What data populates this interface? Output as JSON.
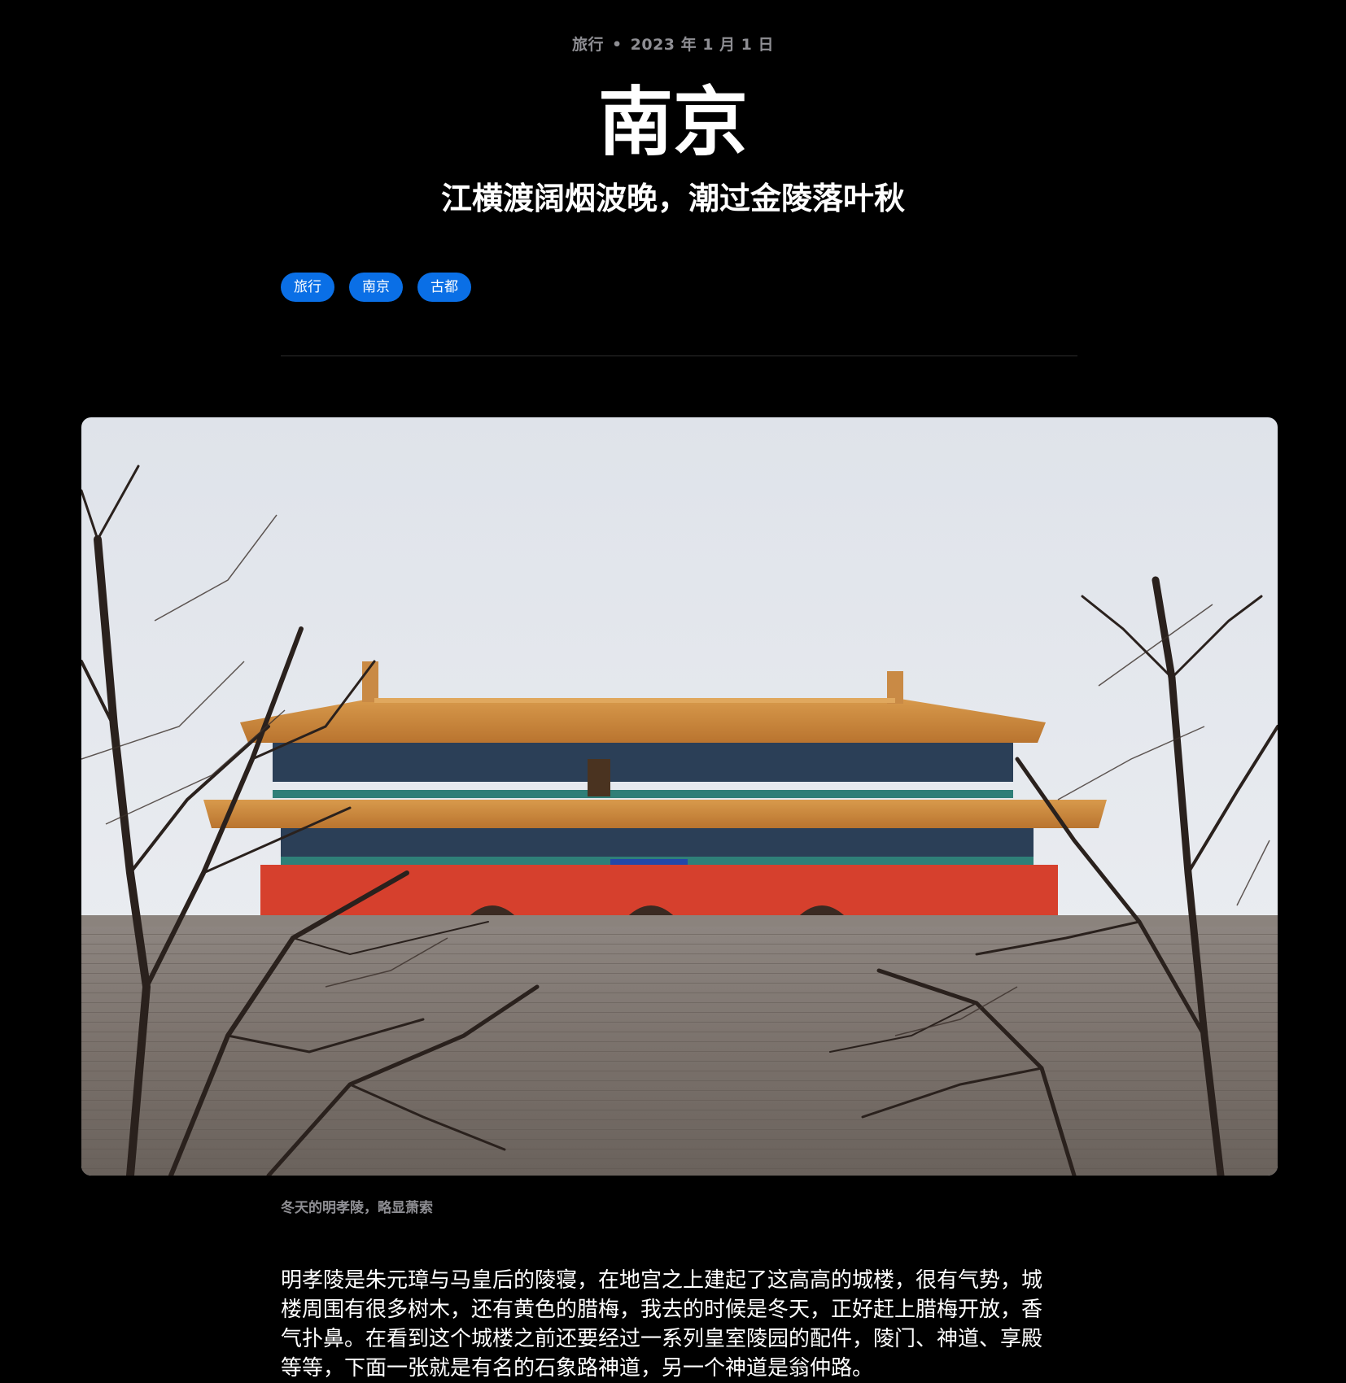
{
  "article": {
    "category": "旅行",
    "separator": "•",
    "date": "2023 年 1 月 1 日",
    "title": "南京",
    "subtitle": "江横渡阔烟波晚，潮过金陵落叶秋",
    "tags": [
      "旅行",
      "南京",
      "古都"
    ],
    "figure": {
      "caption": "冬天的明孝陵，略显萧索"
    },
    "paragraph": "明孝陵是朱元璋与马皇后的陵寝，在地宫之上建起了这高高的城楼，很有气势，城楼周围有很多树木，还有黄色的腊梅，我去的时候是冬天，正好赶上腊梅开放，香气扑鼻。在看到这个城楼之前还要经过一系列皇室陵园的配件，陵门、神道、享殿等等，下面一张就是有名的石象路神道，另一个神道是翁仲路。"
  },
  "colors": {
    "background": "#000000",
    "tag_background": "#0a6fe6",
    "meta_text": "#8e8e93",
    "divider": "#2e2e2e"
  }
}
